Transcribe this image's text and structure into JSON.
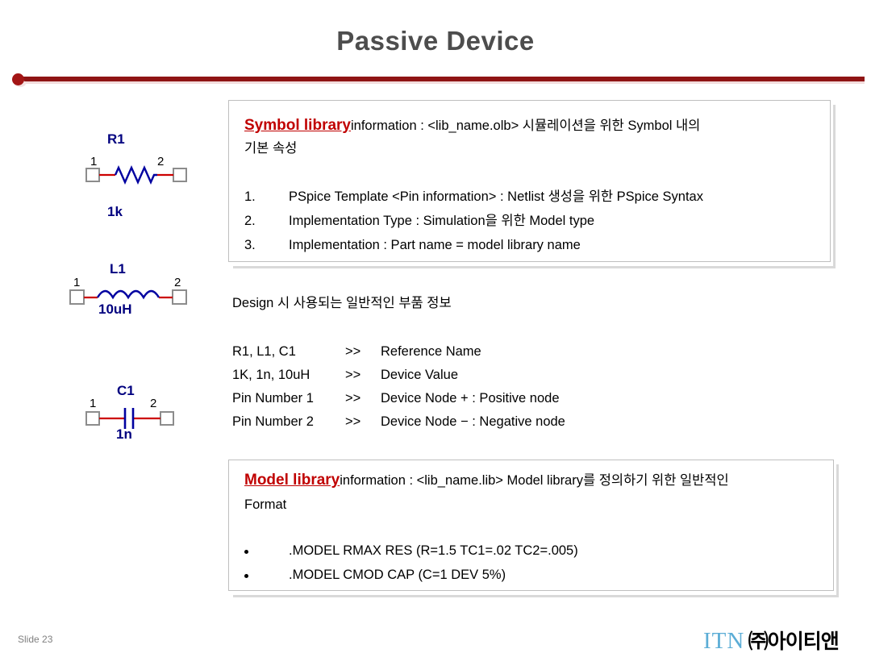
{
  "slide": {
    "title": "Passive Device",
    "number_label": "Slide 23",
    "accent_color": "#8f1414",
    "box_border_color": "#bfbfbf"
  },
  "logo": {
    "latin": "ITN",
    "korean": "㈜아이티앤",
    "latin_color": "#5badd6",
    "korean_color": "#000000"
  },
  "symbols": {
    "resistor": {
      "reference": "R1",
      "value": "1k",
      "pin1": "1",
      "pin2": "2",
      "body_color": "#0000a0",
      "lead_color": "#cc0000",
      "pin_box_color": "#808080"
    },
    "inductor": {
      "reference": "L1",
      "value": "10uH",
      "pin1": "1",
      "pin2": "2",
      "body_color": "#0000a0",
      "lead_color": "#cc0000",
      "pin_box_color": "#808080"
    },
    "capacitor": {
      "reference": "C1",
      "value": "1n",
      "pin1": "1",
      "pin2": "2",
      "body_color": "#0000a0",
      "lead_color": "#cc0000",
      "pin_box_color": "#808080"
    }
  },
  "symbol_box": {
    "heading": "Symbol library",
    "heading_color": "#c00000",
    "intro_line1": "information : <lib_name.olb> 시뮬레이션을 위한 Symbol 내의",
    "intro_line2": "기본 속성",
    "items": [
      {
        "number": "1.",
        "text": "PSpice Template <Pin information> : Netlist 생성을 위한 PSpice Syntax"
      },
      {
        "number": "2.",
        "text": "Implementation Type : Simulation을 위한 Model type"
      },
      {
        "number": "3.",
        "text": "Implementation : Part name = model library name"
      }
    ]
  },
  "middle_block": {
    "heading": "Design 시 사용되는 일반적인 부품 정보",
    "rows": [
      {
        "left": "R1, L1, C1",
        "arrow": ">>",
        "right": "Reference Name"
      },
      {
        "left": "1K, 1n, 10uH",
        "arrow": ">>",
        "right": " Device Value"
      },
      {
        "left": "Pin Number 1",
        "arrow": ">>",
        "right": "Device Node + : Positive node"
      },
      {
        "left": "Pin Number 2",
        "arrow": ">>",
        "right": "Device Node − : Negative node"
      }
    ]
  },
  "model_box": {
    "heading": "Model library",
    "heading_color": "#c00000",
    "intro_line1": "information : <lib_name.lib> Model library를 정의하기 위한 일반적인",
    "intro_line2": "Format",
    "items": [
      {
        "bullet": "•",
        "text": ".MODEL RMAX RES (R=1.5 TC1=.02 TC2=.005)"
      },
      {
        "bullet": "•",
        "text": ".MODEL CMOD CAP (C=1 DEV 5%)"
      }
    ]
  }
}
